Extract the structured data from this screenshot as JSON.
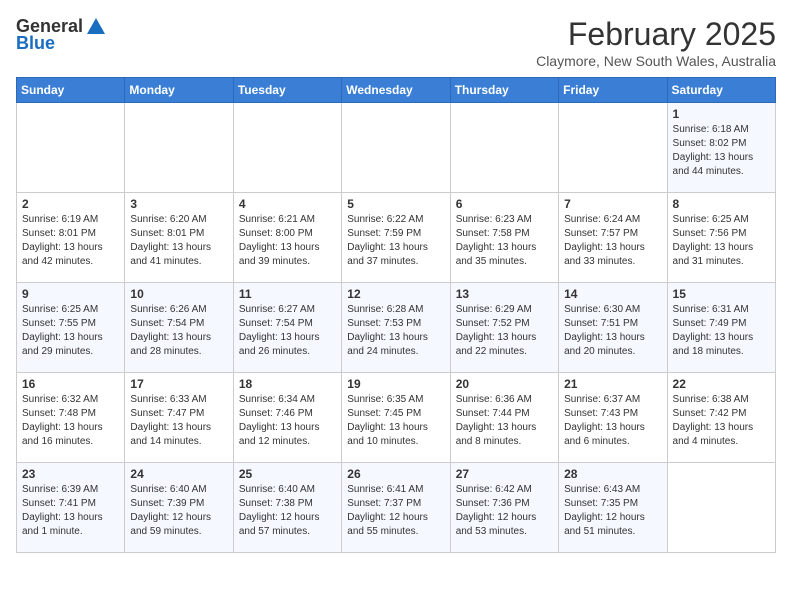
{
  "header": {
    "logo_general": "General",
    "logo_blue": "Blue",
    "title": "February 2025",
    "location": "Claymore, New South Wales, Australia"
  },
  "weekdays": [
    "Sunday",
    "Monday",
    "Tuesday",
    "Wednesday",
    "Thursday",
    "Friday",
    "Saturday"
  ],
  "weeks": [
    [
      {
        "day": "",
        "info": ""
      },
      {
        "day": "",
        "info": ""
      },
      {
        "day": "",
        "info": ""
      },
      {
        "day": "",
        "info": ""
      },
      {
        "day": "",
        "info": ""
      },
      {
        "day": "",
        "info": ""
      },
      {
        "day": "1",
        "info": "Sunrise: 6:18 AM\nSunset: 8:02 PM\nDaylight: 13 hours\nand 44 minutes."
      }
    ],
    [
      {
        "day": "2",
        "info": "Sunrise: 6:19 AM\nSunset: 8:01 PM\nDaylight: 13 hours\nand 42 minutes."
      },
      {
        "day": "3",
        "info": "Sunrise: 6:20 AM\nSunset: 8:01 PM\nDaylight: 13 hours\nand 41 minutes."
      },
      {
        "day": "4",
        "info": "Sunrise: 6:21 AM\nSunset: 8:00 PM\nDaylight: 13 hours\nand 39 minutes."
      },
      {
        "day": "5",
        "info": "Sunrise: 6:22 AM\nSunset: 7:59 PM\nDaylight: 13 hours\nand 37 minutes."
      },
      {
        "day": "6",
        "info": "Sunrise: 6:23 AM\nSunset: 7:58 PM\nDaylight: 13 hours\nand 35 minutes."
      },
      {
        "day": "7",
        "info": "Sunrise: 6:24 AM\nSunset: 7:57 PM\nDaylight: 13 hours\nand 33 minutes."
      },
      {
        "day": "8",
        "info": "Sunrise: 6:25 AM\nSunset: 7:56 PM\nDaylight: 13 hours\nand 31 minutes."
      }
    ],
    [
      {
        "day": "9",
        "info": "Sunrise: 6:25 AM\nSunset: 7:55 PM\nDaylight: 13 hours\nand 29 minutes."
      },
      {
        "day": "10",
        "info": "Sunrise: 6:26 AM\nSunset: 7:54 PM\nDaylight: 13 hours\nand 28 minutes."
      },
      {
        "day": "11",
        "info": "Sunrise: 6:27 AM\nSunset: 7:54 PM\nDaylight: 13 hours\nand 26 minutes."
      },
      {
        "day": "12",
        "info": "Sunrise: 6:28 AM\nSunset: 7:53 PM\nDaylight: 13 hours\nand 24 minutes."
      },
      {
        "day": "13",
        "info": "Sunrise: 6:29 AM\nSunset: 7:52 PM\nDaylight: 13 hours\nand 22 minutes."
      },
      {
        "day": "14",
        "info": "Sunrise: 6:30 AM\nSunset: 7:51 PM\nDaylight: 13 hours\nand 20 minutes."
      },
      {
        "day": "15",
        "info": "Sunrise: 6:31 AM\nSunset: 7:49 PM\nDaylight: 13 hours\nand 18 minutes."
      }
    ],
    [
      {
        "day": "16",
        "info": "Sunrise: 6:32 AM\nSunset: 7:48 PM\nDaylight: 13 hours\nand 16 minutes."
      },
      {
        "day": "17",
        "info": "Sunrise: 6:33 AM\nSunset: 7:47 PM\nDaylight: 13 hours\nand 14 minutes."
      },
      {
        "day": "18",
        "info": "Sunrise: 6:34 AM\nSunset: 7:46 PM\nDaylight: 13 hours\nand 12 minutes."
      },
      {
        "day": "19",
        "info": "Sunrise: 6:35 AM\nSunset: 7:45 PM\nDaylight: 13 hours\nand 10 minutes."
      },
      {
        "day": "20",
        "info": "Sunrise: 6:36 AM\nSunset: 7:44 PM\nDaylight: 13 hours\nand 8 minutes."
      },
      {
        "day": "21",
        "info": "Sunrise: 6:37 AM\nSunset: 7:43 PM\nDaylight: 13 hours\nand 6 minutes."
      },
      {
        "day": "22",
        "info": "Sunrise: 6:38 AM\nSunset: 7:42 PM\nDaylight: 13 hours\nand 4 minutes."
      }
    ],
    [
      {
        "day": "23",
        "info": "Sunrise: 6:39 AM\nSunset: 7:41 PM\nDaylight: 13 hours\nand 1 minute."
      },
      {
        "day": "24",
        "info": "Sunrise: 6:40 AM\nSunset: 7:39 PM\nDaylight: 12 hours\nand 59 minutes."
      },
      {
        "day": "25",
        "info": "Sunrise: 6:40 AM\nSunset: 7:38 PM\nDaylight: 12 hours\nand 57 minutes."
      },
      {
        "day": "26",
        "info": "Sunrise: 6:41 AM\nSunset: 7:37 PM\nDaylight: 12 hours\nand 55 minutes."
      },
      {
        "day": "27",
        "info": "Sunrise: 6:42 AM\nSunset: 7:36 PM\nDaylight: 12 hours\nand 53 minutes."
      },
      {
        "day": "28",
        "info": "Sunrise: 6:43 AM\nSunset: 7:35 PM\nDaylight: 12 hours\nand 51 minutes."
      },
      {
        "day": "",
        "info": ""
      }
    ]
  ]
}
